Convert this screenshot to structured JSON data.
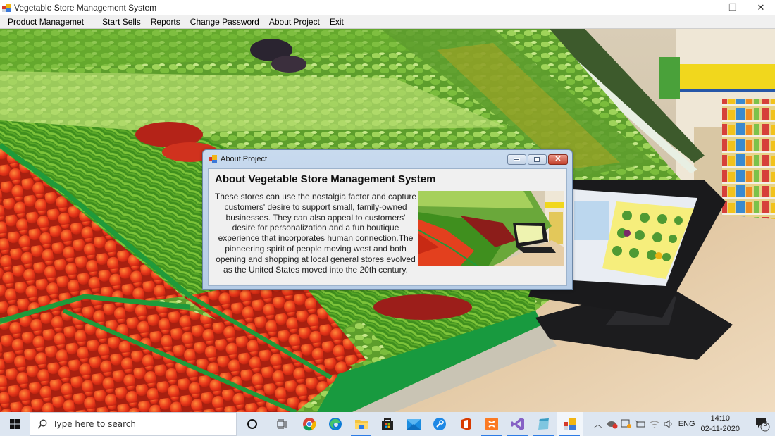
{
  "window": {
    "title": "Vegetable Store Management System",
    "controls": {
      "minimize": "—",
      "restore": "❐",
      "close": "✕"
    }
  },
  "menubar": {
    "items": [
      {
        "label": "Product Managemet"
      },
      {
        "label": "Start Sells"
      },
      {
        "label": "Reports"
      },
      {
        "label": "Change Password"
      },
      {
        "label": "About Project"
      },
      {
        "label": "Exit"
      }
    ]
  },
  "dialog": {
    "title": "About Project",
    "heading": "About Vegetable Store Management System",
    "paragraph": "These stores can use the nostalgia factor and capture customers' desire to support small, family-owned businesses. They can also appeal to customers' desire for personalization and a fun boutique experience that incorporates human connection.The pioneering spirit of people moving west and both opening and shopping at local general stores evolved as the United States moved into the 20th century.",
    "image_alt": "Vegetable store with POS terminal",
    "controls": {
      "close": "✕"
    }
  },
  "background": {
    "description": "Supermarket vegetable aisle with tomatoes, green beans, peppers and a POS touchscreen terminal"
  },
  "taskbar": {
    "search_placeholder": "Type here to search",
    "pinned": [
      {
        "name": "chrome",
        "running": false
      },
      {
        "name": "edge",
        "running": false
      },
      {
        "name": "file-explorer",
        "running": true
      },
      {
        "name": "microsoft-store",
        "running": false
      },
      {
        "name": "mail",
        "running": false
      },
      {
        "name": "settings-tool",
        "running": false
      },
      {
        "name": "office",
        "running": false
      },
      {
        "name": "xampp",
        "running": true
      },
      {
        "name": "visual-studio",
        "running": true
      },
      {
        "name": "notepad",
        "running": true
      },
      {
        "name": "vegetable-store-app",
        "running": true,
        "active": true
      }
    ],
    "tray": {
      "language": "ENG",
      "time": "14:10",
      "date": "02-11-2020",
      "notification_count": "5"
    }
  },
  "colors": {
    "menubar_bg": "#f0f0f0",
    "dialog_frame": "#c8daee",
    "dialog_close": "#c2412c",
    "taskbar_bg": "#dde6f1",
    "taskbar_running": "#2c7be5"
  }
}
